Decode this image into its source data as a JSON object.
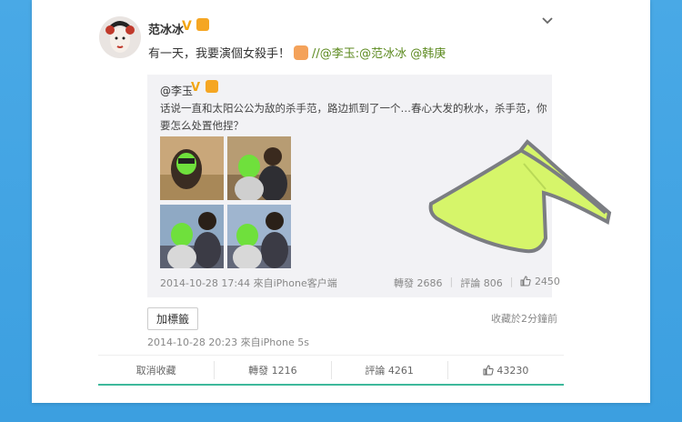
{
  "post": {
    "author": "范冰冰",
    "text_main": "有一天，我要演個女殺手！",
    "text_links": "//@李玉:@范冰冰 @韩庚",
    "tag_button": "加標籤",
    "favorite_time": "收藏於2分鐘前",
    "timestamp": "2014-10-28 20:23 來自iPhone 5s"
  },
  "repost": {
    "author": "@李玉",
    "text": "话说一直和太阳公公为敌的杀手范，路边抓到了一个…春心大发的秋水，杀手范，你要怎么处置他捏？",
    "timestamp": "2014-10-28 17:44 來自iPhone客户端",
    "reposts": "轉發 2686",
    "comments": "評論 806",
    "likes": "2450"
  },
  "actions": {
    "cancel_favorite": "取消收藏",
    "reposts": "轉發 1216",
    "comments": "評論 4261",
    "likes": "43230"
  },
  "colors": {
    "background": "#3c9fe0",
    "link": "#5c8a1f",
    "verified": "#f2a613",
    "visor": "#d6f56a",
    "green_bar": "#3eb99b"
  },
  "icons": [
    "verified-v-icon",
    "medal-icon",
    "chevron-down-icon",
    "thumbs-up-icon"
  ]
}
